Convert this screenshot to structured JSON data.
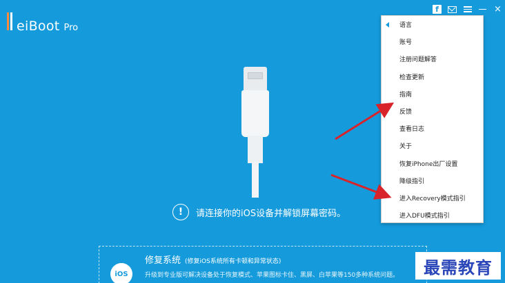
{
  "app": {
    "name": "eiBoot",
    "edition": "Pro"
  },
  "titlebar": {
    "facebook_glyph": "f",
    "close_glyph": "×"
  },
  "main": {
    "connect_prompt": "请连接你的iOS设备并解锁屏幕密码。",
    "info_glyph": "!"
  },
  "repair": {
    "title": "修复系统",
    "subtitle": "(修复iOS系统所有卡顿和异常状态)",
    "description": "升级到专业版可解决设备处于恢复模式、苹果图标卡住、黑屏、白苹果等150多种系统问题。",
    "badge": "iOS"
  },
  "menu": {
    "items": [
      {
        "label": "语言"
      },
      {
        "label": "账号"
      },
      {
        "label": "注册问题解答"
      },
      {
        "label": "检查更新"
      },
      {
        "label": "指南"
      },
      {
        "label": "反馈"
      },
      {
        "label": "查看日志"
      },
      {
        "label": "关于"
      },
      {
        "label": "恢复iPhone出厂设置"
      },
      {
        "label": "降级指引"
      },
      {
        "label": "进入Recovery模式指引"
      },
      {
        "label": "进入DFU模式指引"
      }
    ]
  },
  "watermark": "最需教育",
  "colors": {
    "background": "#159bdc",
    "arrow": "#d8232a",
    "logo_accent": "#ff8a3c"
  }
}
